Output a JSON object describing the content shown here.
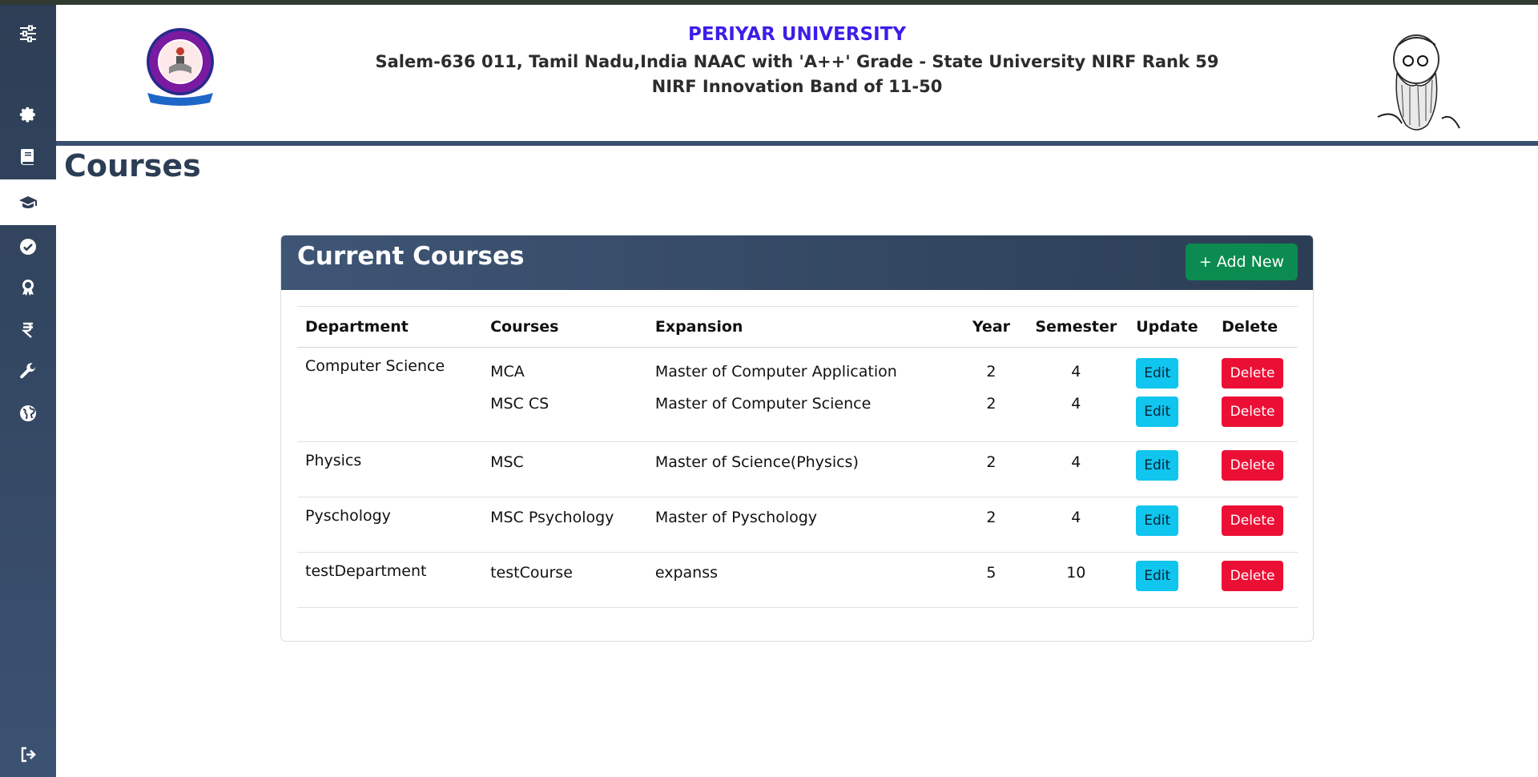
{
  "header": {
    "title": "PERIYAR UNIVERSITY",
    "line1": "Salem-636 011, Tamil Nadu,India NAAC with 'A++' Grade - State University NIRF Rank 59",
    "line2": "NIRF Innovation Band of 11-50"
  },
  "sidebar": {
    "items": [
      {
        "icon": "sliders-icon"
      },
      {
        "icon": "gear-icon"
      },
      {
        "icon": "book-icon"
      },
      {
        "icon": "graduation-cap-icon",
        "active": true
      },
      {
        "icon": "check-circle-icon"
      },
      {
        "icon": "award-ribbon-icon"
      },
      {
        "icon": "rupee-icon"
      },
      {
        "icon": "wrench-icon"
      },
      {
        "icon": "globe-icon"
      },
      {
        "icon": "sign-out-icon"
      }
    ]
  },
  "page": {
    "title": "Courses"
  },
  "card": {
    "title": "Current Courses",
    "add_label": "+ Add New"
  },
  "table": {
    "headers": [
      "Department",
      "Courses",
      "Expansion",
      "Year",
      "Semester",
      "Update",
      "Delete"
    ],
    "edit_label": "Edit",
    "delete_label": "Delete",
    "groups": [
      {
        "department": "Computer Science",
        "courses": [
          {
            "course": "MCA",
            "expansion": "Master of Computer Application",
            "year": "2",
            "semester": "4"
          },
          {
            "course": "MSC CS",
            "expansion": "Master of Computer Science",
            "year": "2",
            "semester": "4"
          }
        ]
      },
      {
        "department": "Physics",
        "courses": [
          {
            "course": "MSC",
            "expansion": "Master of Science(Physics)",
            "year": "2",
            "semester": "4"
          }
        ]
      },
      {
        "department": "Pyschology",
        "courses": [
          {
            "course": "MSC Psychology",
            "expansion": "Master of Pyschology",
            "year": "2",
            "semester": "4"
          }
        ]
      },
      {
        "department": "testDepartment",
        "courses": [
          {
            "course": "testCourse",
            "expansion": "expanss",
            "year": "5",
            "semester": "10"
          }
        ]
      }
    ]
  },
  "colors": {
    "sidebar": "#2d3e55",
    "title_blue": "#3b1ee8",
    "add_button": "#0b8b4f",
    "edit_button": "#10c5ee",
    "delete_button": "#ec0f35"
  }
}
